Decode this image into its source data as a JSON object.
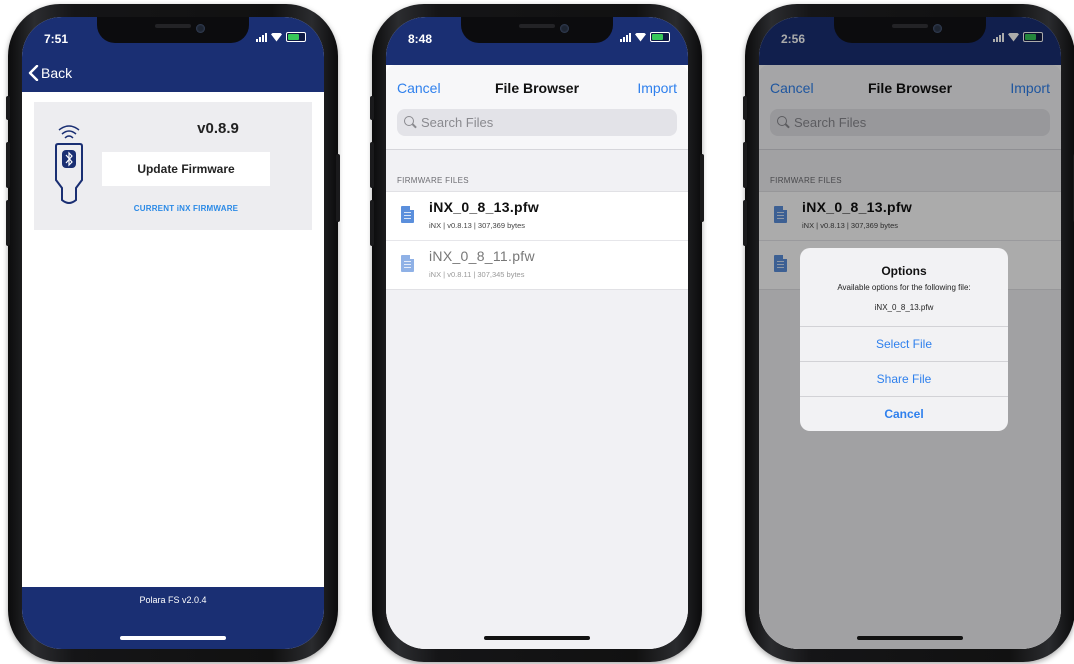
{
  "phone1": {
    "time": "7:51",
    "back_label": "Back",
    "version": "v0.8.9",
    "update_button": "Update Firmware",
    "current_label": "CURRENT iNX FIRMWARE",
    "footer_text": "Polara FS v2.0.4"
  },
  "phone2": {
    "time": "8:48",
    "nav": {
      "cancel": "Cancel",
      "title": "File Browser",
      "import": "Import"
    },
    "search_placeholder": "Search Files",
    "section": "FIRMWARE FILES",
    "files": [
      {
        "name": "iNX_0_8_13.pfw",
        "meta": "iNX | v0.8.13 | 307,369 bytes"
      },
      {
        "name": "iNX_0_8_11.pfw",
        "meta": "iNX | v0.8.11 | 307,345 bytes"
      }
    ]
  },
  "phone3": {
    "time": "2:56",
    "nav": {
      "cancel": "Cancel",
      "title": "File Browser",
      "import": "Import"
    },
    "search_placeholder": "Search Files",
    "section": "FIRMWARE FILES",
    "files": [
      {
        "name": "iNX_0_8_13.pfw",
        "meta": "iNX | v0.8.13 | 307,369 bytes"
      }
    ],
    "dialog": {
      "title": "Options",
      "message": "Available options for the following file:",
      "filename": "iNX_0_8_13.pfw",
      "buttons": [
        "Select File",
        "Share File",
        "Cancel"
      ]
    }
  },
  "colors": {
    "navy": "#1a2f73",
    "ios_blue": "#2f80ed",
    "link_blue": "#2b8ae6"
  }
}
